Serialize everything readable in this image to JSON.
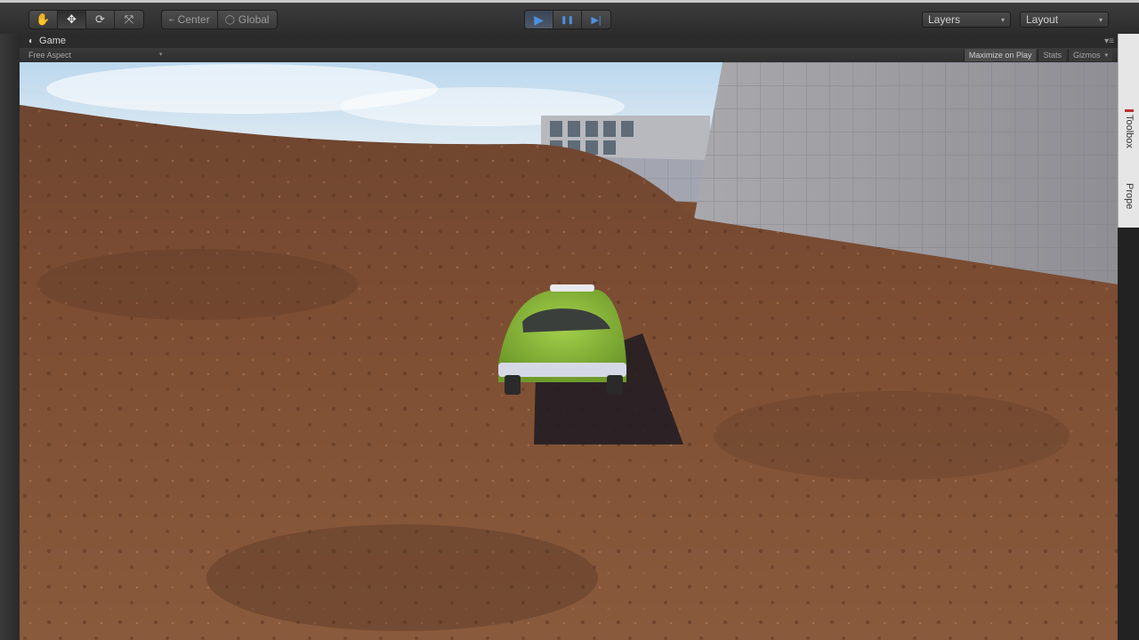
{
  "toolbar": {
    "transform_tools": [
      {
        "icon": "hand-icon",
        "glyph": "✋"
      },
      {
        "icon": "move-icon",
        "glyph": "✥"
      },
      {
        "icon": "rotate-icon",
        "glyph": "⟳"
      },
      {
        "icon": "scale-icon",
        "glyph": "⤧"
      }
    ],
    "pivot_center_label": "Center",
    "pivot_global_label": "Global",
    "play_icon": "▶",
    "pause_icon": "❚❚",
    "step_icon": "▶|",
    "layers_label": "Layers",
    "layout_label": "Layout"
  },
  "game_panel": {
    "tab_label": "Game",
    "aspect_label": "Free Aspect",
    "maximize_label": "Maximize on Play",
    "stats_label": "Stats",
    "gizmos_label": "Gizmos"
  },
  "side_panel": {
    "toolbox_label": "Toolbox",
    "properties_label": "Prope"
  },
  "colors": {
    "play_accent": "#4f8fe0",
    "ground": "#7a4b30",
    "car": "#8fbf3a"
  }
}
